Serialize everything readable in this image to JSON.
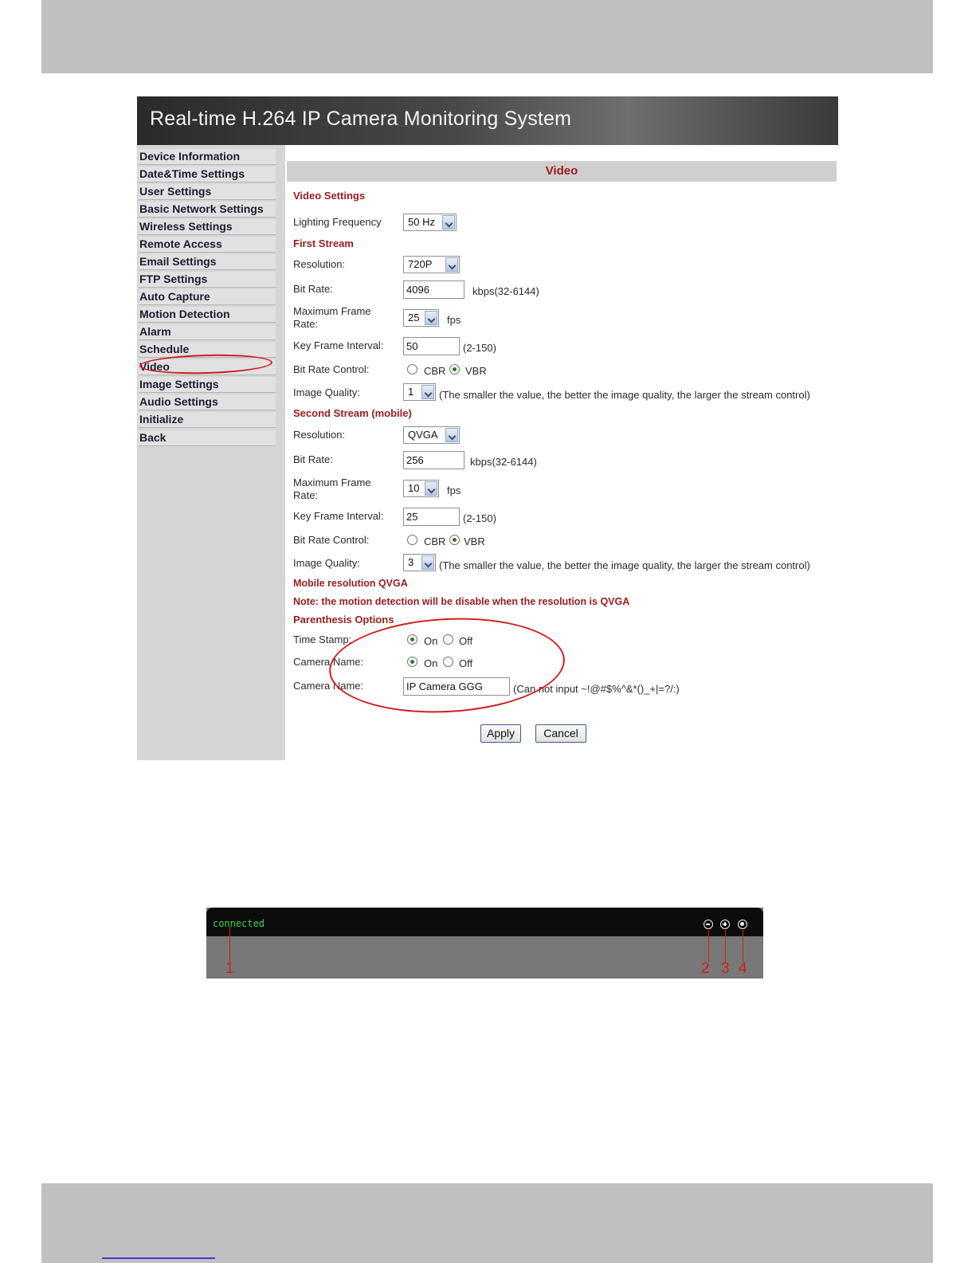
{
  "camera_ui": {
    "banner_title": "Real-time H.264 IP Camera Monitoring System",
    "sidebar": {
      "items": [
        {
          "label": "Device Information"
        },
        {
          "label": "Date&Time Settings"
        },
        {
          "label": "User Settings"
        },
        {
          "label": "Basic Network Settings"
        },
        {
          "label": "Wireless Settings"
        },
        {
          "label": "Remote Access"
        },
        {
          "label": "Email Settings"
        },
        {
          "label": "FTP Settings"
        },
        {
          "label": "Auto Capture"
        },
        {
          "label": "Motion Detection"
        },
        {
          "label": "Alarm"
        },
        {
          "label": "Schedule"
        },
        {
          "label": "Video"
        },
        {
          "label": "Image Settings"
        },
        {
          "label": "Audio Settings"
        },
        {
          "label": "Initialize"
        },
        {
          "label": "Back"
        }
      ]
    },
    "page_title": "Video",
    "video_settings": {
      "heading": "Video Settings",
      "lighting_frequency": {
        "label": "Lighting Frequency",
        "value": "50 Hz"
      }
    },
    "first_stream": {
      "heading": "First Stream",
      "resolution": {
        "label": "Resolution:",
        "value": "720P"
      },
      "bit_rate": {
        "label": "Bit Rate:",
        "value": "4096",
        "hint": "kbps(32-6144)"
      },
      "max_frame_rate": {
        "label_line1": "Maximum Frame",
        "label_line2": "Rate:",
        "value": "25",
        "unit": "fps"
      },
      "key_frame_interval": {
        "label": "Key Frame Interval:",
        "value": "50",
        "hint": "(2-150)"
      },
      "bit_rate_control": {
        "label": "Bit Rate Control:",
        "options": [
          "CBR",
          "VBR"
        ],
        "selected": "VBR"
      },
      "image_quality": {
        "label": "Image Quality:",
        "value": "1",
        "hint": "(The smaller the value, the better the image quality, the larger the stream control)"
      }
    },
    "second_stream": {
      "heading": "Second Stream (mobile)",
      "resolution": {
        "label": "Resolution:",
        "value": "QVGA"
      },
      "bit_rate": {
        "label": "Bit Rate:",
        "value": "256",
        "hint": "kbps(32-6144)"
      },
      "max_frame_rate": {
        "label_line1": "Maximum Frame",
        "label_line2": "Rate:",
        "value": "10",
        "unit": "fps"
      },
      "key_frame_interval": {
        "label": "Key Frame Interval:",
        "value": "25",
        "hint": "(2-150)"
      },
      "bit_rate_control": {
        "label": "Bit Rate Control:",
        "options": [
          "CBR",
          "VBR"
        ],
        "selected": "VBR"
      },
      "image_quality": {
        "label": "Image Quality:",
        "value": "3",
        "hint": "(The smaller the value, the better the image quality, the larger the stream control)"
      }
    },
    "mobile_resolution_note": "Mobile resolution QVGA",
    "motion_note": "Note: the motion detection will be disable when the resolution is QVGA",
    "parenthesis_options": {
      "heading": "Parenthesis Options",
      "time_stamp": {
        "label": "Time Stamp:",
        "options": [
          "On",
          "Off"
        ],
        "selected": "On"
      },
      "camera_name_toggle": {
        "label": "Camera Name:",
        "options": [
          "On",
          "Off"
        ],
        "selected": "On"
      },
      "camera_name_text": {
        "label": "Camera Name:",
        "value": "IP Camera GGG",
        "hint": "(Can not input ~!@#$%^&*()_+|=?/:)"
      }
    },
    "buttons": {
      "apply": "Apply",
      "cancel": "Cancel"
    },
    "annotation_color": "#d11d1d"
  },
  "video_toolbar": {
    "status": "connected",
    "status_color": "#3bd64a",
    "controls": [
      {
        "icon": "zoom-out-icon"
      },
      {
        "icon": "zoom-in-icon"
      },
      {
        "icon": "record-icon"
      }
    ],
    "callouts": [
      "1",
      "2",
      "3",
      "4"
    ]
  }
}
